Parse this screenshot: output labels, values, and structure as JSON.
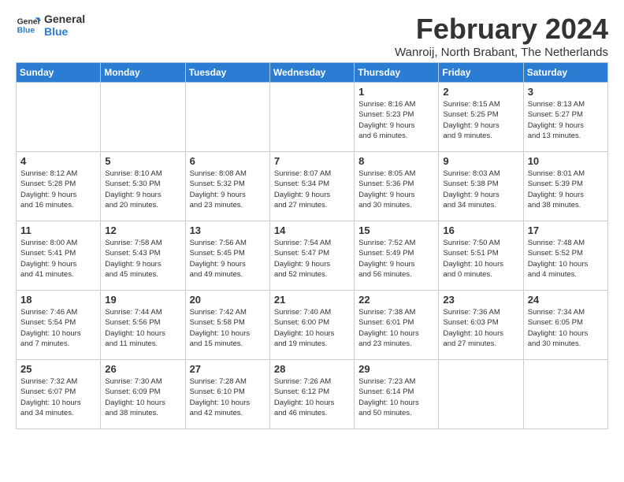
{
  "header": {
    "logo_line1": "General",
    "logo_line2": "Blue",
    "month_year": "February 2024",
    "location": "Wanroij, North Brabant, The Netherlands"
  },
  "days_of_week": [
    "Sunday",
    "Monday",
    "Tuesday",
    "Wednesday",
    "Thursday",
    "Friday",
    "Saturday"
  ],
  "weeks": [
    [
      {
        "day": "",
        "detail": ""
      },
      {
        "day": "",
        "detail": ""
      },
      {
        "day": "",
        "detail": ""
      },
      {
        "day": "",
        "detail": ""
      },
      {
        "day": "1",
        "detail": "Sunrise: 8:16 AM\nSunset: 5:23 PM\nDaylight: 9 hours\nand 6 minutes."
      },
      {
        "day": "2",
        "detail": "Sunrise: 8:15 AM\nSunset: 5:25 PM\nDaylight: 9 hours\nand 9 minutes."
      },
      {
        "day": "3",
        "detail": "Sunrise: 8:13 AM\nSunset: 5:27 PM\nDaylight: 9 hours\nand 13 minutes."
      }
    ],
    [
      {
        "day": "4",
        "detail": "Sunrise: 8:12 AM\nSunset: 5:28 PM\nDaylight: 9 hours\nand 16 minutes."
      },
      {
        "day": "5",
        "detail": "Sunrise: 8:10 AM\nSunset: 5:30 PM\nDaylight: 9 hours\nand 20 minutes."
      },
      {
        "day": "6",
        "detail": "Sunrise: 8:08 AM\nSunset: 5:32 PM\nDaylight: 9 hours\nand 23 minutes."
      },
      {
        "day": "7",
        "detail": "Sunrise: 8:07 AM\nSunset: 5:34 PM\nDaylight: 9 hours\nand 27 minutes."
      },
      {
        "day": "8",
        "detail": "Sunrise: 8:05 AM\nSunset: 5:36 PM\nDaylight: 9 hours\nand 30 minutes."
      },
      {
        "day": "9",
        "detail": "Sunrise: 8:03 AM\nSunset: 5:38 PM\nDaylight: 9 hours\nand 34 minutes."
      },
      {
        "day": "10",
        "detail": "Sunrise: 8:01 AM\nSunset: 5:39 PM\nDaylight: 9 hours\nand 38 minutes."
      }
    ],
    [
      {
        "day": "11",
        "detail": "Sunrise: 8:00 AM\nSunset: 5:41 PM\nDaylight: 9 hours\nand 41 minutes."
      },
      {
        "day": "12",
        "detail": "Sunrise: 7:58 AM\nSunset: 5:43 PM\nDaylight: 9 hours\nand 45 minutes."
      },
      {
        "day": "13",
        "detail": "Sunrise: 7:56 AM\nSunset: 5:45 PM\nDaylight: 9 hours\nand 49 minutes."
      },
      {
        "day": "14",
        "detail": "Sunrise: 7:54 AM\nSunset: 5:47 PM\nDaylight: 9 hours\nand 52 minutes."
      },
      {
        "day": "15",
        "detail": "Sunrise: 7:52 AM\nSunset: 5:49 PM\nDaylight: 9 hours\nand 56 minutes."
      },
      {
        "day": "16",
        "detail": "Sunrise: 7:50 AM\nSunset: 5:51 PM\nDaylight: 10 hours\nand 0 minutes."
      },
      {
        "day": "17",
        "detail": "Sunrise: 7:48 AM\nSunset: 5:52 PM\nDaylight: 10 hours\nand 4 minutes."
      }
    ],
    [
      {
        "day": "18",
        "detail": "Sunrise: 7:46 AM\nSunset: 5:54 PM\nDaylight: 10 hours\nand 7 minutes."
      },
      {
        "day": "19",
        "detail": "Sunrise: 7:44 AM\nSunset: 5:56 PM\nDaylight: 10 hours\nand 11 minutes."
      },
      {
        "day": "20",
        "detail": "Sunrise: 7:42 AM\nSunset: 5:58 PM\nDaylight: 10 hours\nand 15 minutes."
      },
      {
        "day": "21",
        "detail": "Sunrise: 7:40 AM\nSunset: 6:00 PM\nDaylight: 10 hours\nand 19 minutes."
      },
      {
        "day": "22",
        "detail": "Sunrise: 7:38 AM\nSunset: 6:01 PM\nDaylight: 10 hours\nand 23 minutes."
      },
      {
        "day": "23",
        "detail": "Sunrise: 7:36 AM\nSunset: 6:03 PM\nDaylight: 10 hours\nand 27 minutes."
      },
      {
        "day": "24",
        "detail": "Sunrise: 7:34 AM\nSunset: 6:05 PM\nDaylight: 10 hours\nand 30 minutes."
      }
    ],
    [
      {
        "day": "25",
        "detail": "Sunrise: 7:32 AM\nSunset: 6:07 PM\nDaylight: 10 hours\nand 34 minutes."
      },
      {
        "day": "26",
        "detail": "Sunrise: 7:30 AM\nSunset: 6:09 PM\nDaylight: 10 hours\nand 38 minutes."
      },
      {
        "day": "27",
        "detail": "Sunrise: 7:28 AM\nSunset: 6:10 PM\nDaylight: 10 hours\nand 42 minutes."
      },
      {
        "day": "28",
        "detail": "Sunrise: 7:26 AM\nSunset: 6:12 PM\nDaylight: 10 hours\nand 46 minutes."
      },
      {
        "day": "29",
        "detail": "Sunrise: 7:23 AM\nSunset: 6:14 PM\nDaylight: 10 hours\nand 50 minutes."
      },
      {
        "day": "",
        "detail": ""
      },
      {
        "day": "",
        "detail": ""
      }
    ]
  ]
}
